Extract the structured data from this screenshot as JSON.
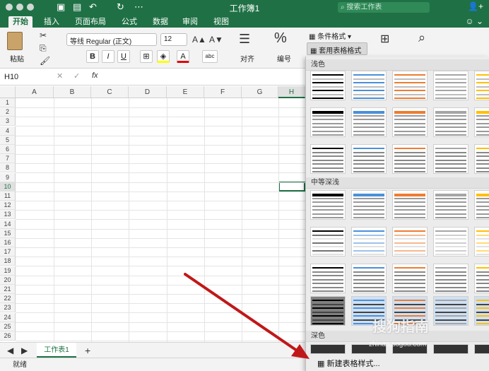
{
  "window": {
    "title": "工作簿1",
    "search_placeholder": "搜索工作表"
  },
  "tabs": [
    "开始",
    "插入",
    "页面布局",
    "公式",
    "数据",
    "审阅",
    "视图"
  ],
  "ribbon": {
    "paste_label": "粘贴",
    "font_name": "等线 Regular (正文)",
    "font_size": "12",
    "bold": "B",
    "italic": "I",
    "underline": "U",
    "align_label": "对齐",
    "number_label": "编号",
    "conditional_format": "条件格式",
    "format_as_table": "套用表格格式"
  },
  "formula_bar": {
    "cell_ref": "H10",
    "fx": "fx",
    "value": ""
  },
  "columns": [
    "A",
    "B",
    "C",
    "D",
    "E",
    "F",
    "G",
    "H"
  ],
  "selected_column": "H",
  "rows": [
    "1",
    "2",
    "3",
    "4",
    "5",
    "6",
    "7",
    "8",
    "9",
    "10",
    "11",
    "12",
    "13",
    "14",
    "15",
    "16",
    "17",
    "18",
    "19",
    "20",
    "21",
    "22",
    "23",
    "24",
    "25",
    "26"
  ],
  "selected_row": "10",
  "sheet_tab": "工作表1",
  "add_sheet": "+",
  "status": "就绪",
  "gallery": {
    "sections": [
      "浅色",
      "中等深浅",
      "深色"
    ],
    "new_style": "新建表格样式...",
    "colors": [
      "#000000",
      "#4a90d9",
      "#ed7d31",
      "#a5a5a5",
      "#ffc000"
    ]
  },
  "watermark": {
    "text": "搜狗指南",
    "url": "zhinan.sogou.com"
  }
}
